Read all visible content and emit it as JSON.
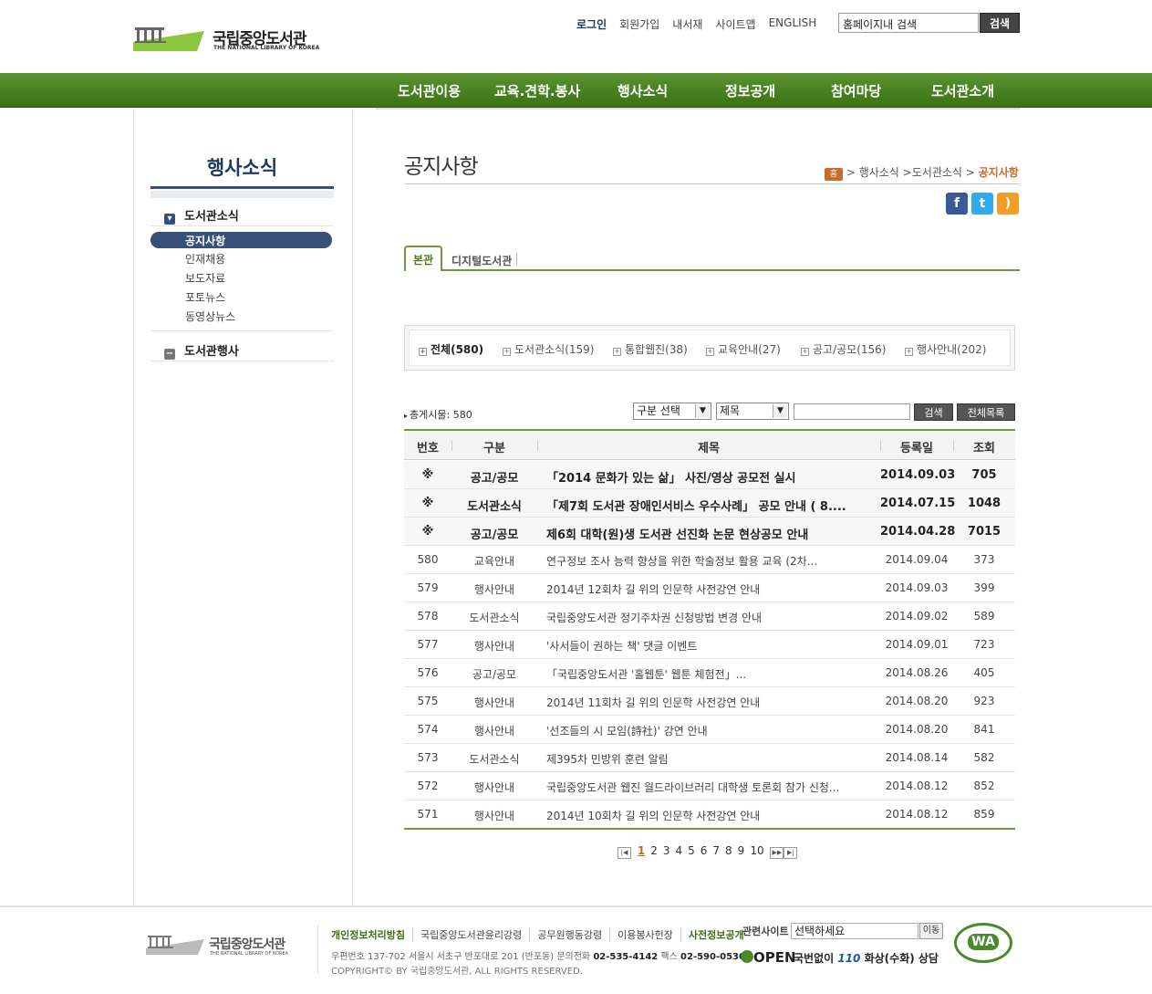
{
  "header": {
    "logo_ko": "국립중앙도서관",
    "logo_en": "THE NATIONAL LIBRARY OF KOREA",
    "utility": [
      "로그인",
      "회원가입",
      "내서재",
      "사이트맵",
      "ENGLISH"
    ],
    "search_value": "홈페이지내 검색",
    "search_button": "검색"
  },
  "gnb": [
    "도서관이용",
    "교육.견학.봉사",
    "행사소식",
    "정보공개",
    "참여마당",
    "도서관소개"
  ],
  "lnb": {
    "title": "행사소식",
    "group1": "도서관소식",
    "group1_items": [
      "공지사항",
      "인재채용",
      "보도자료",
      "포토뉴스",
      "동영상뉴스"
    ],
    "group2": "도서관행사"
  },
  "content": {
    "title": "공지사항",
    "breadcrumb": {
      "home": "홈",
      "path1": "행사소식",
      "path2": "도서관소식",
      "current": "공지사항"
    },
    "tabs": [
      "본관",
      "디지털도서관"
    ],
    "categories": [
      {
        "label": "전체(580)",
        "active": true
      },
      {
        "label": "도서관소식(159)",
        "active": false
      },
      {
        "label": "통합웹진(38)",
        "active": false
      },
      {
        "label": "교육안내(27)",
        "active": false
      },
      {
        "label": "공고/공모(156)",
        "active": false
      },
      {
        "label": "행사안내(202)",
        "active": false
      }
    ],
    "total": "총게시물: 580",
    "select_category": "구분 선택",
    "select_field": "제목",
    "search_button": "검색",
    "list_all_button": "전체목록"
  },
  "table": {
    "headers": [
      "번호",
      "구분",
      "제목",
      "등록일",
      "조회"
    ],
    "rows": [
      {
        "no": "※",
        "cat": "공고/공모",
        "title": "「2014 문화가 있는 삶」 사진/영상 공모전 실시",
        "date": "2014.09.03",
        "hits": "705",
        "notice": true
      },
      {
        "no": "※",
        "cat": "도서관소식",
        "title": "「제7회 도서관 장애인서비스 우수사례」 공모 안내 ( 8....",
        "date": "2014.07.15",
        "hits": "1048",
        "notice": true
      },
      {
        "no": "※",
        "cat": "공고/공모",
        "title": "제6회 대학(원)생 도서관 선진화 논문 현상공모 안내",
        "date": "2014.04.28",
        "hits": "7015",
        "notice": true
      },
      {
        "no": "580",
        "cat": "교육안내",
        "title": "연구정보 조사 능력 향상을 위한 학술정보 활용 교육 (2차...",
        "date": "2014.09.04",
        "hits": "373",
        "notice": false
      },
      {
        "no": "579",
        "cat": "행사안내",
        "title": "2014년 12회차 길 위의 인문학 사전강연 안내",
        "date": "2014.09.03",
        "hits": "399",
        "notice": false
      },
      {
        "no": "578",
        "cat": "도서관소식",
        "title": "국립중앙도서관 정기주차권 신청방법 변경 안내",
        "date": "2014.09.02",
        "hits": "589",
        "notice": false
      },
      {
        "no": "577",
        "cat": "행사안내",
        "title": "'사서들이 권하는 책' 댓글 이벤트",
        "date": "2014.09.01",
        "hits": "723",
        "notice": false
      },
      {
        "no": "576",
        "cat": "공고/공모",
        "title": "「국립중앙도서관 '홀웹툰' 웹툰 체험전」...",
        "date": "2014.08.26",
        "hits": "405",
        "notice": false
      },
      {
        "no": "575",
        "cat": "행사안내",
        "title": "2014년 11회차 길 위의 인문학 사전강연 안내",
        "date": "2014.08.20",
        "hits": "923",
        "notice": false
      },
      {
        "no": "574",
        "cat": "행사안내",
        "title": "'선조들의 시 모임(詩社)' 강연 안내",
        "date": "2014.08.20",
        "hits": "841",
        "notice": false
      },
      {
        "no": "573",
        "cat": "도서관소식",
        "title": "제395차 민방위 훈련 알림",
        "date": "2014.08.14",
        "hits": "582",
        "notice": false
      },
      {
        "no": "572",
        "cat": "행사안내",
        "title": "국립중앙도서관 웹진 월드라이브러리 대학생 토론회 참가 신청...",
        "date": "2014.08.12",
        "hits": "852",
        "notice": false
      },
      {
        "no": "571",
        "cat": "행사안내",
        "title": "2014년 10회차 길 위의 인문학 사전강연 안내",
        "date": "2014.08.12",
        "hits": "859",
        "notice": false
      }
    ]
  },
  "paging": [
    "1",
    "2",
    "3",
    "4",
    "5",
    "6",
    "7",
    "8",
    "9",
    "10"
  ],
  "footer": {
    "links": [
      "개인정보처리방침",
      "국립중앙도서관윤리강령",
      "공무원행동강령",
      "이용봉사헌장",
      "사전정보공개"
    ],
    "address": "우편번호 137-702 서울시 서초구 반포대로 201 (반포동)   문의전화 ",
    "tel": "02-535-4142",
    "fax_label": "  팩스 ",
    "fax": "02-590-0530",
    "copyright": "COPYRIGHT© BY 국립중앙도서관, ALL RIGHTS RESERVED.",
    "related_label": "관련사이트",
    "related_select": "선택하세요",
    "go_button": "이동",
    "open_logo": "OPEN",
    "call_text_1": "국번없이 ",
    "call_110": "110",
    "call_text_2": " 화상(수화) 상담",
    "wa_mark": "WA"
  }
}
